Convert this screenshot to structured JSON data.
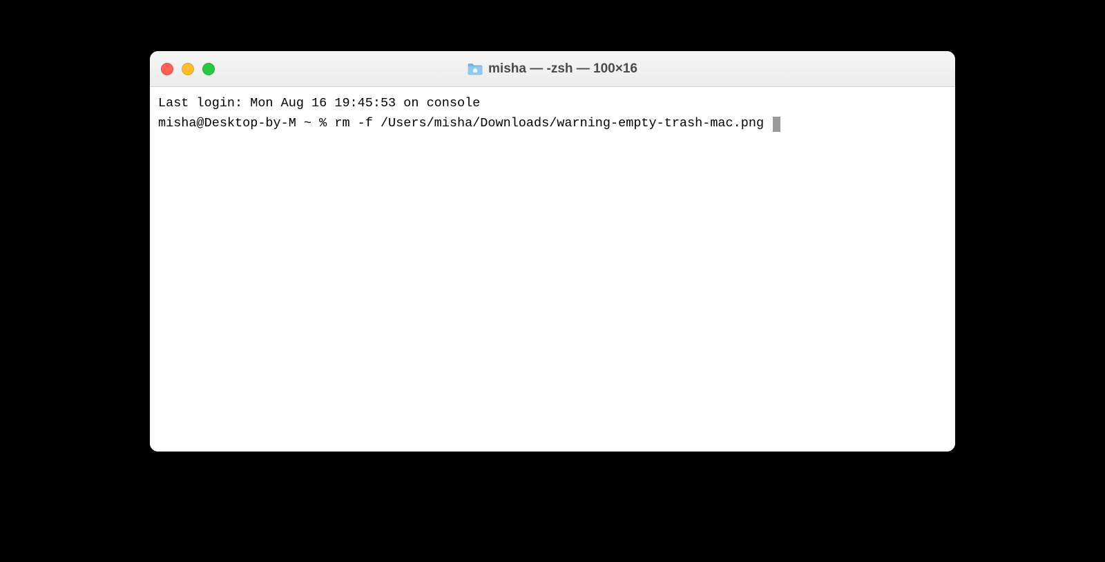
{
  "window": {
    "title": "misha — -zsh — 100×16"
  },
  "terminal": {
    "line1": "Last login: Mon Aug 16 19:45:53 on console",
    "prompt": "misha@Desktop-by-M ~ % ",
    "command": "rm -f /Users/misha/Downloads/warning-empty-trash-mac.png "
  }
}
